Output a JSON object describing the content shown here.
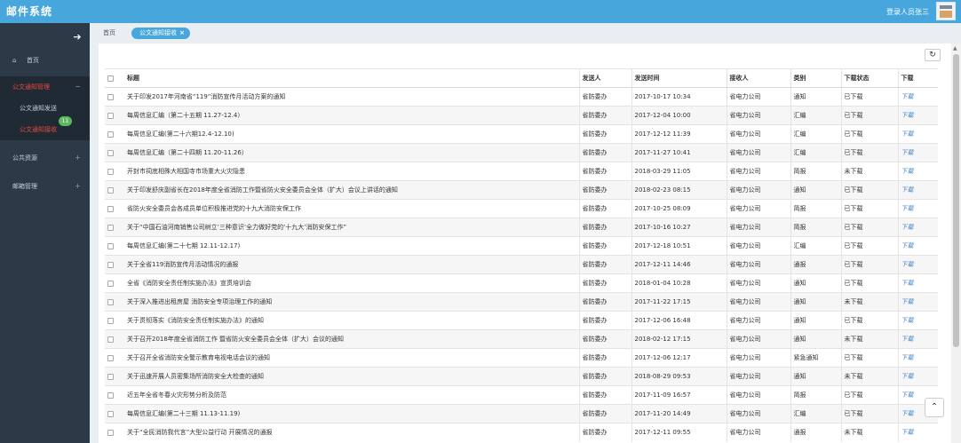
{
  "app": {
    "title": "邮件系统",
    "user_label": "登录人员张三"
  },
  "sidebar": {
    "home": "首页",
    "group_active": "公文通知管理",
    "sub_items": [
      {
        "label": "公文通知发送"
      },
      {
        "label": "公文通知接收",
        "badge": "11"
      }
    ],
    "groups": [
      {
        "label": "公共资源"
      },
      {
        "label": "邮箱管理"
      }
    ]
  },
  "tabs": {
    "home": "首页",
    "active": "公文通知接收",
    "close": "×"
  },
  "table": {
    "headers": {
      "title": "标题",
      "sender": "发送人",
      "time": "发送时间",
      "receiver": "接收人",
      "category": "类别",
      "status": "下载状态",
      "download": "下载"
    },
    "rows": [
      {
        "title": "关于印发2017年河南省“119”消防宣传月活动方案的通知",
        "sender": "省防委办",
        "time": "2017-10-17 10:34",
        "receiver": "省电力公司",
        "category": "通知",
        "status": "已下载",
        "dl": "下载"
      },
      {
        "title": "每周信息汇编（第二十五期 11.27-12.4）",
        "sender": "省防委办",
        "time": "2017-12-04 10:00",
        "receiver": "省电力公司",
        "category": "汇编",
        "status": "已下载",
        "dl": "下载"
      },
      {
        "title": "每周信息汇编(第二十六期12.4-12.10)",
        "sender": "省防委办",
        "time": "2017-12-12 11:39",
        "receiver": "省电力公司",
        "category": "汇编",
        "status": "已下载",
        "dl": "下载"
      },
      {
        "title": "每周信息汇编（第二十四期 11.20-11.26）",
        "sender": "省防委办",
        "time": "2017-11-27 10:41",
        "receiver": "省电力公司",
        "category": "汇编",
        "status": "已下载",
        "dl": "下载"
      },
      {
        "title": "开封市祠底相殊大相国寺市场重大火灾隐患",
        "sender": "省防委办",
        "time": "2018-03-29 11:05",
        "receiver": "省电力公司",
        "category": "简报",
        "status": "未下载",
        "dl": "下载"
      },
      {
        "title": "关于印发舒庆副省长在2018年度全省消防工作暨省防火安全委员会全体（扩大）会议上讲话的通知",
        "sender": "省防委办",
        "time": "2018-02-23 08:15",
        "receiver": "省电力公司",
        "category": "通知",
        "status": "已下载",
        "dl": "下载"
      },
      {
        "title": "省防火安全委员会各成员单位积极推进党的十九大消防安保工作",
        "sender": "省防委办",
        "time": "2017-10-25 08:09",
        "receiver": "省电力公司",
        "category": "简报",
        "status": "已下载",
        "dl": "下载"
      },
      {
        "title": "关于“中国石油河南销售公司树立‘三种意识’全力做好党的‘十九大’消防安保工作”",
        "sender": "省防委办",
        "time": "2017-10-16 10:27",
        "receiver": "省电力公司",
        "category": "简报",
        "status": "已下载",
        "dl": "下载"
      },
      {
        "title": "每周信息汇编(第二十七期 12.11-12.17)",
        "sender": "省防委办",
        "time": "2017-12-18 10:51",
        "receiver": "省电力公司",
        "category": "汇编",
        "status": "已下载",
        "dl": "下载"
      },
      {
        "title": "关于全省119消防宣传月活动情况的通报",
        "sender": "省防委办",
        "time": "2017-12-11 14:46",
        "receiver": "省电力公司",
        "category": "通报",
        "status": "已下载",
        "dl": "下载"
      },
      {
        "title": "全省《消防安全责任制实施办法》宣贯培训会",
        "sender": "省防委办",
        "time": "2018-01-04 10:28",
        "receiver": "省电力公司",
        "category": "通知",
        "status": "已下载",
        "dl": "下载"
      },
      {
        "title": "关于深入推进出租房屋 消防安全专项治理工作的通知",
        "sender": "省防委办",
        "time": "2017-11-22 17:15",
        "receiver": "省电力公司",
        "category": "通知",
        "status": "未下载",
        "dl": "下载"
      },
      {
        "title": "关于贯彻落实《消防安全责任制实施办法》的通知",
        "sender": "省防委办",
        "time": "2017-12-06 16:48",
        "receiver": "省电力公司",
        "category": "通知",
        "status": "已下载",
        "dl": "下载"
      },
      {
        "title": "关于召开2018年度全省消防工作 暨省防火安全委员会全体（扩大）会议的通知",
        "sender": "省防委办",
        "time": "2018-02-12 17:15",
        "receiver": "省电力公司",
        "category": "通知",
        "status": "未下载",
        "dl": "下载"
      },
      {
        "title": "关于召开全省消防安全警示教育电视电话会议的通知",
        "sender": "省防委办",
        "time": "2017-12-06 12:17",
        "receiver": "省电力公司",
        "category": "紧急通知",
        "status": "已下载",
        "dl": "下载"
      },
      {
        "title": "关于迅速开展人员密集场所消防安全大检查的通知",
        "sender": "省防委办",
        "time": "2018-08-29 09:53",
        "receiver": "省电力公司",
        "category": "通知",
        "status": "未下载",
        "dl": "下载"
      },
      {
        "title": "近五年全省冬春火灾形势分析及防范",
        "sender": "省防委办",
        "time": "2017-11-09 16:57",
        "receiver": "省电力公司",
        "category": "简报",
        "status": "已下载",
        "dl": "下载"
      },
      {
        "title": "每周信息汇编(第二十三期 11.13-11.19)",
        "sender": "省防委办",
        "time": "2017-11-20 14:49",
        "receiver": "省电力公司",
        "category": "汇编",
        "status": "已下载",
        "dl": "下载"
      },
      {
        "title": "关于“全民消防我代言”大型公益行动 开展情况的通报",
        "sender": "省防委办",
        "time": "2017-12-11 09:55",
        "receiver": "省电力公司",
        "category": "通报",
        "status": "未下载",
        "dl": "下载"
      }
    ]
  }
}
